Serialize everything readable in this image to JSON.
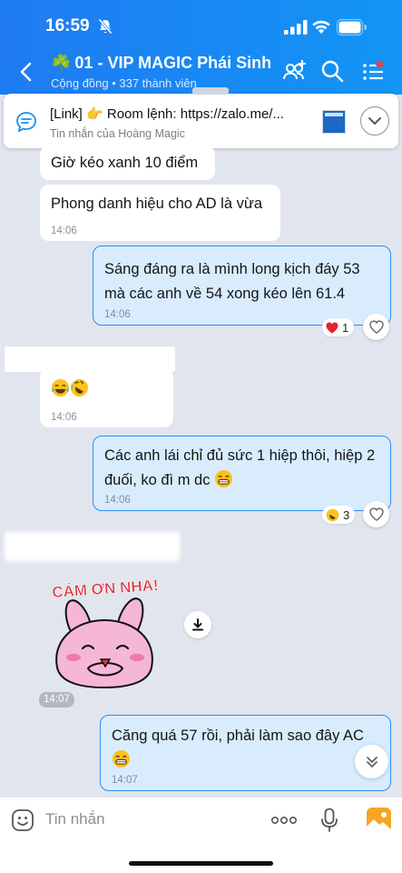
{
  "status_bar": {
    "time": "16:59"
  },
  "header": {
    "title": "01 - VIP MAGIC Phái Sinh",
    "title_emoji": "☘️",
    "subtitle": "Cộng đồng • 337 thành viên"
  },
  "pinned": {
    "title": "[Link] 👉 Room lệnh: https://zalo.me/...",
    "subtitle": "Tin nhắn của Hoàng Magic"
  },
  "messages": [
    {
      "text": "Giờ kéo xanh 10 điểm"
    },
    {
      "text": "Phong danh hiệu cho AD là vừa",
      "time": "14:06"
    },
    {
      "text": "Sáng đáng ra là mình long kịch đáy 53 mà các anh về 54  xong kéo lên 61.4",
      "time": "14:06",
      "reaction_count": "1"
    },
    {
      "time": "14:06"
    },
    {
      "text": "Các anh lái chỉ đủ sức 1 hiệp thôi, hiệp 2 đuối, ko đì m dc",
      "time": "14:06",
      "reaction_count": "3"
    },
    {
      "sticker_text": "CẢM ƠN NHA!",
      "time": "14:07"
    },
    {
      "text": "Căng quá 57 rồi, phải làm sao đây AC",
      "time": "14:07"
    }
  ],
  "composer": {
    "placeholder": "Tin nhắn"
  },
  "colors": {
    "header": "#1b8ff4",
    "outgoing_bubble": "#d8ecfd",
    "outgoing_border": "#2c8df5",
    "chat_bg": "#e1e5ee"
  }
}
